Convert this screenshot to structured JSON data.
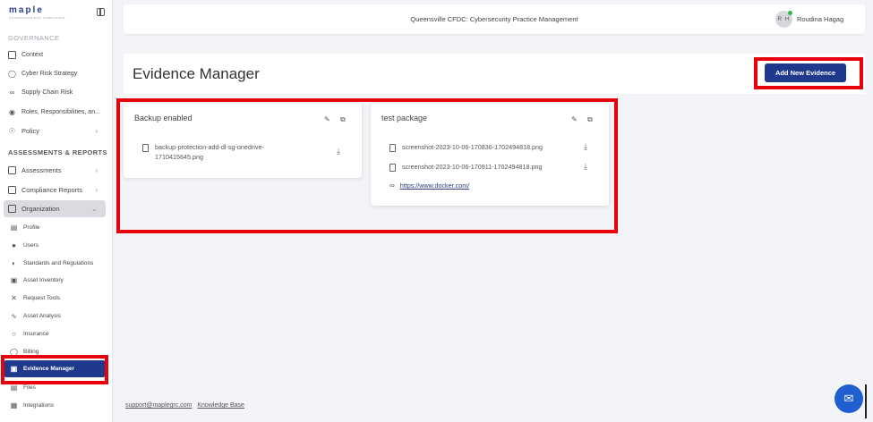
{
  "app": {
    "logo_text": "maple",
    "logo_sub": "GOVERNANCE RISK COMPLIANCE",
    "org_title": "Queensville CFDC: Cybersecurity Practice Management",
    "user_initials": "R H",
    "user_name": "Roudina Hagag"
  },
  "sidebar": {
    "section_governance": "GOVERNANCE",
    "governance_items": [
      {
        "label": "Context",
        "icon": "document-icon"
      },
      {
        "label": "Cyber Risk Strategy",
        "icon": "lightbulb-icon"
      },
      {
        "label": "Supply Chain Risk",
        "icon": "link-icon"
      },
      {
        "label": "Roles, Responsibilities, an...",
        "icon": "shield-icon"
      },
      {
        "label": "Policy",
        "icon": "shield-check-icon"
      }
    ],
    "section_assessments": "ASSESSMENTS & REPORTS",
    "assessment_items": [
      {
        "label": "Assessments",
        "icon": "clipboard-icon"
      },
      {
        "label": "Compliance Reports",
        "icon": "chart-icon"
      },
      {
        "label": "Organization",
        "icon": "building-icon"
      }
    ],
    "org_sub_items": [
      {
        "label": "Profile"
      },
      {
        "label": "Users"
      },
      {
        "label": "Standards and Regulations"
      },
      {
        "label": "Asset Inventory"
      },
      {
        "label": "Request Tools"
      },
      {
        "label": "Asset Analysis"
      },
      {
        "label": "Insurance"
      },
      {
        "label": "Billing"
      },
      {
        "label": "Evidence Manager"
      },
      {
        "label": "Files"
      },
      {
        "label": "Integrations"
      }
    ]
  },
  "page": {
    "title": "Evidence Manager",
    "add_button": "Add New Evidence"
  },
  "cards": [
    {
      "title": "Backup enabled",
      "items": [
        {
          "type": "file",
          "name": "backup-protection-add-dl-sg-onedrive-",
          "name_line2": "1710415645.png"
        }
      ]
    },
    {
      "title": "test package",
      "items": [
        {
          "type": "file",
          "name": "screenshot-2023-10-06-170836-1702494818.png"
        },
        {
          "type": "file",
          "name": "screenshot-2023-10-06-170911-1702494818.png"
        },
        {
          "type": "link",
          "name": "https://www.docker.com/"
        }
      ]
    }
  ],
  "footer": {
    "support": "support@maplegrc.com",
    "kb": "Knowledge Base"
  },
  "colors": {
    "accent": "#1f3a8c",
    "highlight": "#e8000b",
    "online": "#2eb84b"
  }
}
